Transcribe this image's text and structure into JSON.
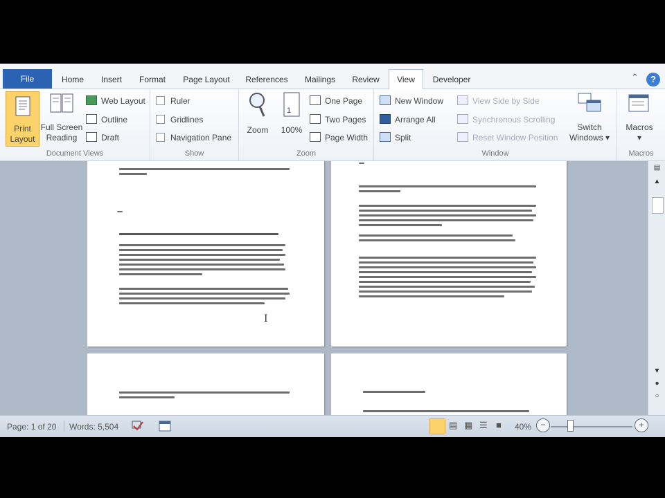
{
  "tabs": [
    "File",
    "Home",
    "Insert",
    "Format",
    "Page Layout",
    "References",
    "Mailings",
    "Review",
    "View",
    "Developer"
  ],
  "active_tab": "View",
  "ribbon": {
    "document_views": {
      "label": "Document Views",
      "print_layout": [
        "Print",
        "Layout"
      ],
      "full_screen_reading": [
        "Full Screen",
        "Reading"
      ],
      "web_layout": "Web Layout",
      "outline": "Outline",
      "draft": "Draft"
    },
    "show": {
      "label": "Show",
      "ruler": "Ruler",
      "gridlines": "Gridlines",
      "navigation_pane": "Navigation Pane"
    },
    "zoom": {
      "label": "Zoom",
      "zoom": "Zoom",
      "hundred": "100%",
      "one_page": "One Page",
      "two_pages": "Two Pages",
      "page_width": "Page Width"
    },
    "window": {
      "label": "Window",
      "new_window": "New Window",
      "arrange_all": "Arrange All",
      "split": "Split",
      "view_side_by_side": "View Side by Side",
      "synchronous_scrolling": "Synchronous Scrolling",
      "reset_window_position": "Reset Window Position",
      "switch_windows": [
        "Switch",
        "Windows"
      ]
    },
    "macros": {
      "label": "Macros",
      "macros": "Macros"
    }
  },
  "status": {
    "page": "Page: 1 of 20",
    "words": "Words: 5,504",
    "zoom": "40%"
  },
  "colors": {
    "file_tab": "#2a62b4",
    "selected_button": "#fbd36a",
    "doc_background": "#aebac8"
  }
}
